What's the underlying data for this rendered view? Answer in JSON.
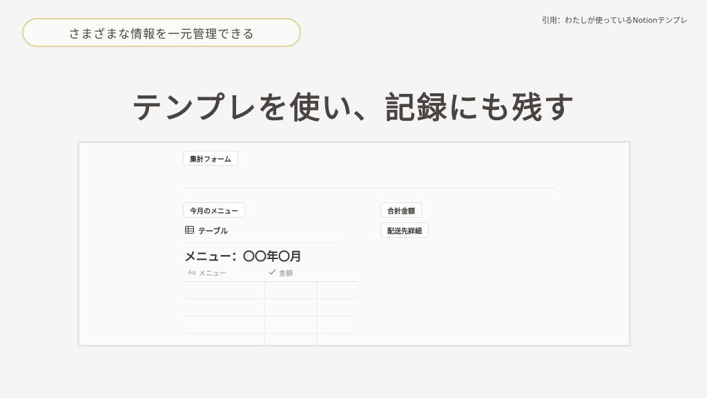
{
  "header": {
    "category_pill": "さまざまな情報を一元管理できる",
    "citation": "引用：わたしが使っているNotionテンプレ",
    "title": "テンプレを使い、記録にも残す"
  },
  "notion_page": {
    "top_button": "集計フォーム",
    "left_button": "今月のメニュー",
    "right_buttons": [
      "合計金額",
      "配送先詳細"
    ],
    "database": {
      "view_icon": "table-icon",
      "view_name": "テーブル",
      "title": "メニュー：〇〇年〇月",
      "columns": [
        {
          "icon": "text-property-icon",
          "icon_label": "Aa",
          "name": "メニュー"
        },
        {
          "icon": "checkmark-icon",
          "name": "金額"
        }
      ],
      "rows": [
        [],
        [],
        [],
        []
      ]
    }
  },
  "colors": {
    "background": "#f5f5f5",
    "text": "#4a4440",
    "pill_border": "#ddd59a",
    "screen_border": "#e4e4e4"
  }
}
